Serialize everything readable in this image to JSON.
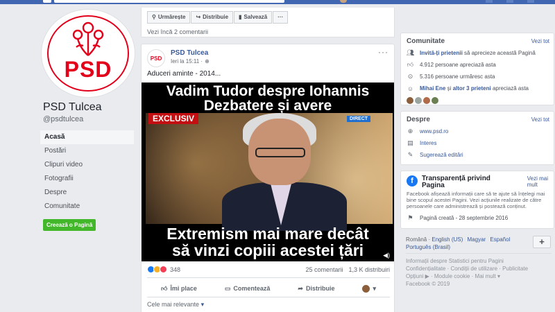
{
  "page": {
    "name": "PSD Tulcea",
    "handle": "@psdtulcea",
    "logo_text": "PSD"
  },
  "nav": {
    "items": [
      "Acasă",
      "Postări",
      "Clipuri video",
      "Fotografii",
      "Despre",
      "Comunitate"
    ],
    "create_label": "Creează o Pagină"
  },
  "top_actions": {
    "follow": "Urmărește",
    "share": "Distribuie",
    "save": "Salvează",
    "more": "···",
    "more_comments": "Vezi încă 2 comentarii"
  },
  "post": {
    "author": "PSD Tulcea",
    "time": "Ieri la 15:11 ·",
    "text": "Aduceri aminte - 2014...",
    "menu": "···",
    "video": {
      "title_line1": "Vadim Tudor despre Iohannis",
      "title_line2": "Dezbatere și avere",
      "badge_exclusive": "EXCLUSIV",
      "badge_direct": "DIRECT",
      "bottom_line1": "Extremism mai mare decât",
      "bottom_line2": "să vinzi copiii acestei țări"
    },
    "reaction_count": "348",
    "comments": "25 comentarii",
    "shares": "1,3 K distribuiri",
    "like_label": "Îmi place",
    "comment_label": "Comentează",
    "share_label": "Distribuie",
    "relevance_label": "Cele mai relevante",
    "relevance_arrow": "▾"
  },
  "community": {
    "title": "Comunitate",
    "see_all": "Vezi tot",
    "invite_link": "Invită-ți prietenii",
    "invite_rest": "să aprecieze această Pagină",
    "likes": "4.912 persoane apreciază asta",
    "follows": "5.316 persoane urmăresc asta",
    "friends_name": "Mihai Ene",
    "friends_and": "și",
    "friends_others": "altor 3 prieteni",
    "friends_rest": "apreciază asta"
  },
  "about": {
    "title": "Despre",
    "see_all": "Vezi tot",
    "website": "www.psd.ro",
    "category": "Interes",
    "suggest": "Sugerează editări"
  },
  "transparency": {
    "title_line1": "Transparență privind",
    "title_line2": "Pagina",
    "see_more_line1": "Vezi mai",
    "see_more_line2": "mult",
    "text": "Facebook afișează informații care să te ajute să înțelegi mai bine scopul acestei Pagini. Vezi acțiunile realizate de către persoanele care administrează și postează conținut.",
    "created": "Pagină creată - 28 septembrie 2016"
  },
  "languages": {
    "current": "Română",
    "l1": "English (US)",
    "l2": "Magyar",
    "l3": "Español",
    "l4": "Português (Brasil)",
    "plus": "+"
  },
  "footer": {
    "line1": "Informații despre Statistici pentru Pagini",
    "line2": "Confidențialitate · Condiții de utilizare · Publicitate",
    "line3": "Opțiuni ▶ · Module cookie · Mai mult ▾",
    "line4": "Facebook © 2019"
  },
  "colors": {
    "brand_red": "#e2001a",
    "facebook_blue": "#4267b2",
    "link_blue": "#385898",
    "create_green": "#42b72a"
  },
  "icons": [
    "follow-icon",
    "share-icon",
    "bookmark-icon",
    "globe-icon",
    "like-icon",
    "comment-icon",
    "share-arrow-icon",
    "people-icon",
    "thumb-icon",
    "rss-icon",
    "website-icon",
    "category-icon",
    "edit-icon",
    "flag-icon",
    "sound-icon"
  ]
}
